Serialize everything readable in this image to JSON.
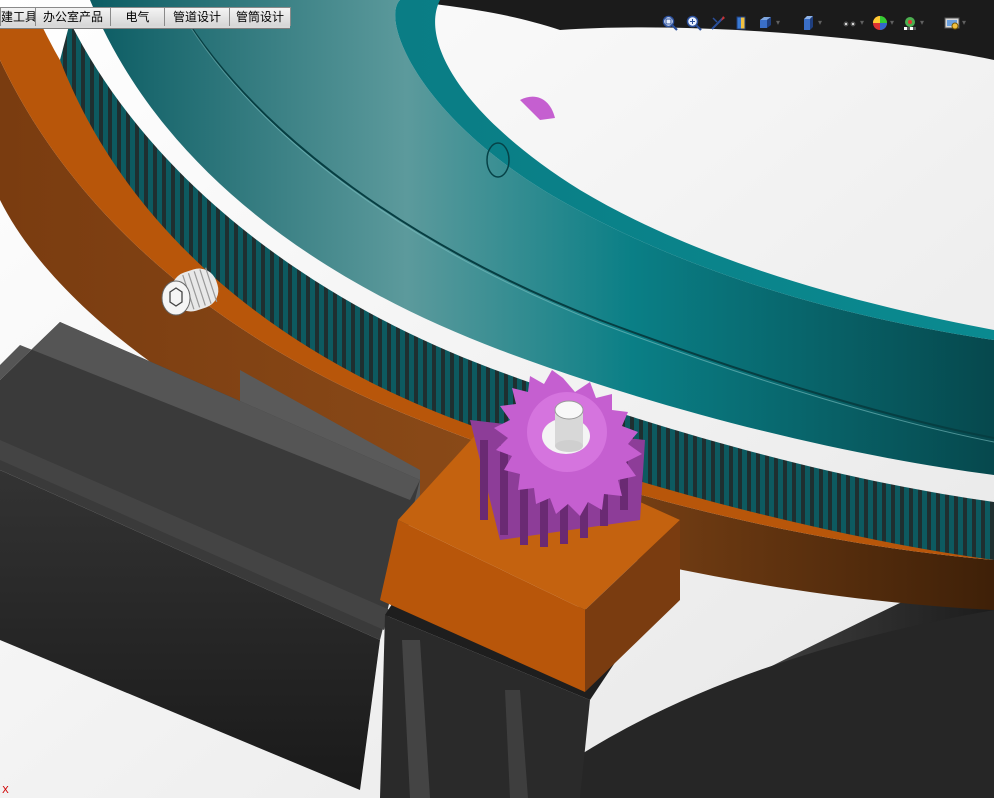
{
  "command_tabs": [
    {
      "id": "tools",
      "label": "建工具"
    },
    {
      "id": "office",
      "label": "办公室产品"
    },
    {
      "id": "electrical",
      "label": "电气"
    },
    {
      "id": "piping",
      "label": "管道设计"
    },
    {
      "id": "tubing",
      "label": "管筒设计"
    }
  ],
  "view_toolbar": [
    {
      "name": "zoom-to-fit-icon"
    },
    {
      "name": "zoom-to-area-icon"
    },
    {
      "name": "previous-view-icon"
    },
    {
      "name": "section-view-icon"
    },
    {
      "name": "view-orientation-icon"
    },
    {
      "name": "display-style-icon"
    },
    {
      "name": "hide-show-items-icon"
    },
    {
      "name": "edit-appearance-icon"
    },
    {
      "name": "apply-scene-icon"
    },
    {
      "name": "view-settings-icon"
    }
  ],
  "triad": {
    "x_label": "X"
  },
  "colors": {
    "gear_ring_teal": "#0a7f86",
    "base_plate_orange": "#b8560a",
    "pinion_magenta": "#c55fd0",
    "motor_black": "#222222",
    "background": "#f2f2f2"
  }
}
